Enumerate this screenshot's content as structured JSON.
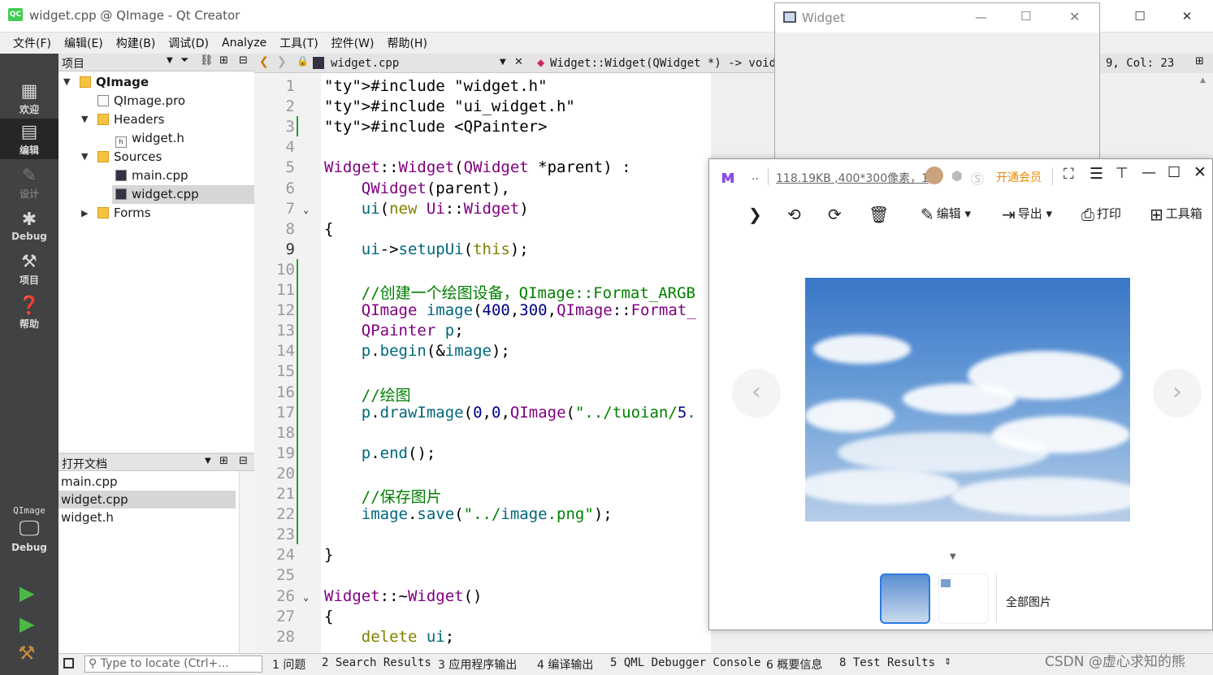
{
  "window": {
    "title": "widget.cpp @ QImage - Qt Creator",
    "icon_text": "QC"
  },
  "menu": [
    "文件(F)",
    "编辑(E)",
    "构建(B)",
    "调试(D)",
    "Analyze",
    "工具(T)",
    "控件(W)",
    "帮助(H)"
  ],
  "modes": [
    {
      "label": "欢迎",
      "icon": "grid-icon"
    },
    {
      "label": "编辑",
      "icon": "edit-icon"
    },
    {
      "label": "设计",
      "icon": "pen-icon"
    },
    {
      "label": "Debug",
      "icon": "bug-icon"
    },
    {
      "label": "项目",
      "icon": "wrench-icon"
    },
    {
      "label": "帮助",
      "icon": "help-icon"
    }
  ],
  "kit": {
    "project": "QImage",
    "build": "Debug"
  },
  "project_panel": {
    "title": "项目",
    "tree": [
      {
        "label": "QImage",
        "bold": true
      },
      {
        "label": "QImage.pro"
      },
      {
        "label": "Headers"
      },
      {
        "label": "widget.h"
      },
      {
        "label": "Sources"
      },
      {
        "label": "main.cpp"
      },
      {
        "label": "widget.cpp",
        "selected": true
      },
      {
        "label": "Forms"
      }
    ]
  },
  "open_docs": {
    "title": "打开文档",
    "items": [
      "main.cpp",
      "widget.cpp",
      "widget.h"
    ],
    "selected": 1
  },
  "editor": {
    "file_tab": "widget.cpp",
    "symbol": "Widget::Widget(QWidget *) -> void",
    "cursor": "9, Col: 23",
    "line_numbers": [
      "1",
      "2",
      "3",
      "4",
      "5",
      "6",
      "7",
      "8",
      "9",
      "10",
      "11",
      "12",
      "13",
      "14",
      "15",
      "16",
      "17",
      "18",
      "19",
      "20",
      "21",
      "22",
      "23",
      "24",
      "25",
      "26",
      "27",
      "28"
    ],
    "lines": [
      "#include \"widget.h\"",
      "#include \"ui_widget.h\"",
      "#include <QPainter>",
      "",
      "Widget::Widget(QWidget *parent) :",
      "    QWidget(parent),",
      "    ui(new Ui::Widget)",
      "{",
      "    ui->setupUi(this);",
      "",
      "    //创建一个绘图设备，QImage::Format_ARGB",
      "    QImage image(400,300,QImage::Format_",
      "    QPainter p;",
      "    p.begin(&image);",
      "",
      "    //绘图",
      "    p.drawImage(0,0,QImage(\"../tuoian/5.",
      "",
      "    p.end();",
      "",
      "    //保存图片",
      "    image.save(\"../image.png\");",
      "",
      "}",
      "",
      "Widget::~Widget()",
      "{",
      "    delete ui;"
    ]
  },
  "status": {
    "locate_placeholder": "Type to locate (Ctrl+...",
    "tabs": [
      "1 问题",
      "2 Search Results",
      "3 应用程序输出",
      "4 编译输出",
      "5 QML Debugger Console",
      "6 概要信息",
      "8 Test Results"
    ]
  },
  "widget_window": {
    "title": "Widget"
  },
  "viewer": {
    "info": "118.19KB ,400*300像素，1",
    "dots": "..",
    "vip": "开通会员",
    "tools": {
      "edit": "编辑",
      "export": "导出",
      "print": "打印",
      "toolbox": "工具箱"
    },
    "all_images": "全部图片"
  },
  "watermark": "CSDN @虚心求知的熊",
  "colors": {
    "accent_vip": "#e98a00",
    "mode_bar": "#404244",
    "thumb_border": "#2b7be4"
  }
}
